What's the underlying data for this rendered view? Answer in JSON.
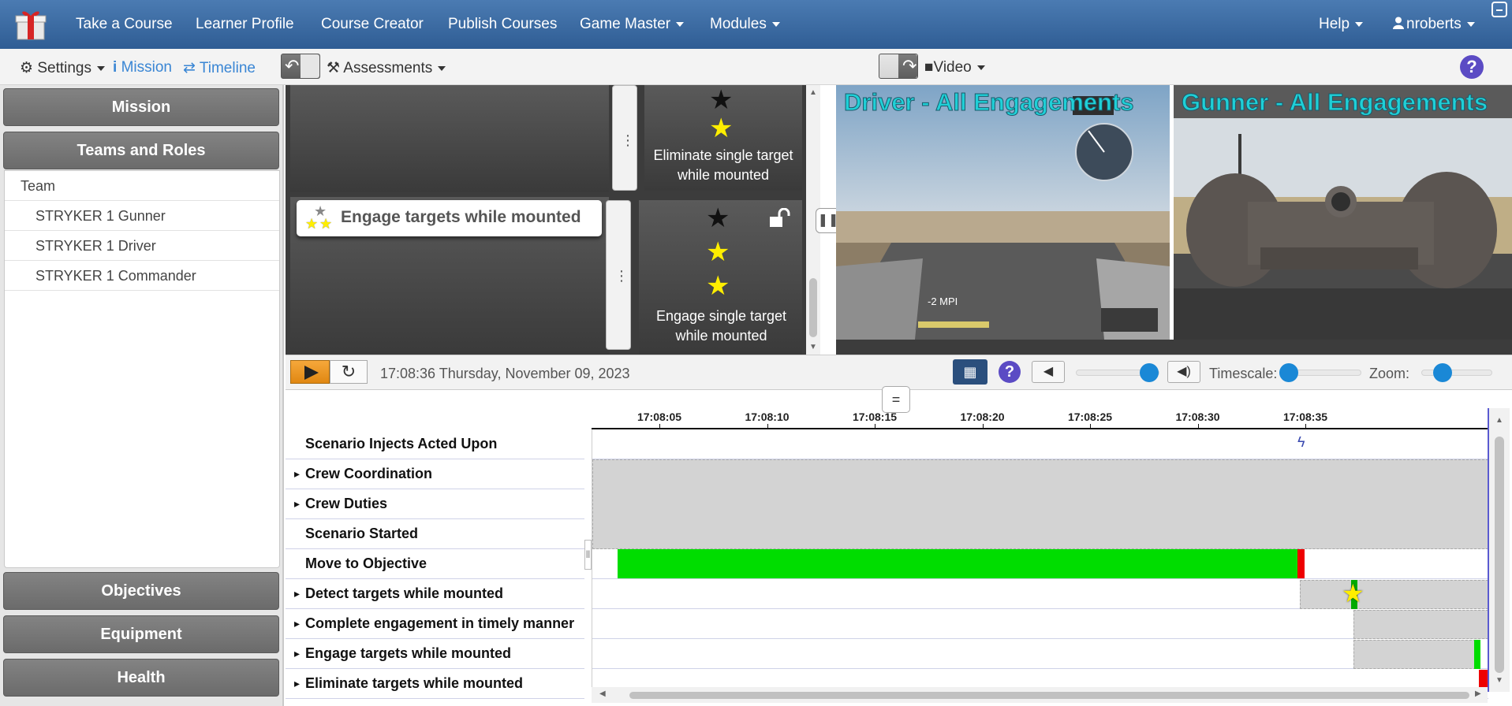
{
  "nav": {
    "items": [
      "Take a Course",
      "Learner Profile",
      "Course Creator",
      "Publish Courses",
      "Game Master",
      "Modules"
    ],
    "help": "Help",
    "user": "nroberts"
  },
  "toolbar": {
    "settings": "Settings",
    "mission": "Mission",
    "timeline": "Timeline",
    "assessments": "Assessments",
    "video": "Video"
  },
  "sidebar": {
    "mission": "Mission",
    "teams_roles": "Teams and Roles",
    "team_rows": [
      "Team",
      "STRYKER 1 Gunner",
      "STRYKER 1 Driver",
      "STRYKER 1 Commander"
    ],
    "objectives": "Objectives",
    "equipment": "Equipment",
    "health": "Health"
  },
  "cards": {
    "eliminate_text": "Eliminate single target while mounted",
    "engage_title": "Engage targets while mounted",
    "engage_text": "Engage single target while mounted"
  },
  "videos": {
    "driver_title": "Driver - All Engagements",
    "gunner_title": "Gunner - All Engagements",
    "driver_hud": "-2 MPI"
  },
  "playback": {
    "datetime": "17:08:36 Thursday, November 09, 2023",
    "timescale_label": "Timescale:",
    "zoom_label": "Zoom:",
    "volume_level": 0.88,
    "timescale_level": 0.08,
    "zoom_level": 0.3
  },
  "timeline": {
    "ticks": [
      "17:08:05",
      "17:08:10",
      "17:08:15",
      "17:08:20",
      "17:08:25",
      "17:08:30",
      "17:08:35"
    ],
    "rows": [
      {
        "label": "Scenario Injects Acted Upon",
        "expandable": false
      },
      {
        "label": "Crew Coordination",
        "expandable": true
      },
      {
        "label": "Crew Duties",
        "expandable": true
      },
      {
        "label": "Scenario Started",
        "expandable": false
      },
      {
        "label": "Move to Objective",
        "expandable": false
      },
      {
        "label": "Detect targets while mounted",
        "expandable": true
      },
      {
        "label": "Complete engagement in timely manner",
        "expandable": true
      },
      {
        "label": "Engage targets while mounted",
        "expandable": true
      },
      {
        "label": "Eliminate targets while mounted",
        "expandable": true
      }
    ]
  },
  "colors": {
    "nav_bg": "#3a6aa3",
    "green": "#00dd00",
    "red": "#ee0000",
    "video_title": "#1fd0d7",
    "play": "#f0981f"
  }
}
